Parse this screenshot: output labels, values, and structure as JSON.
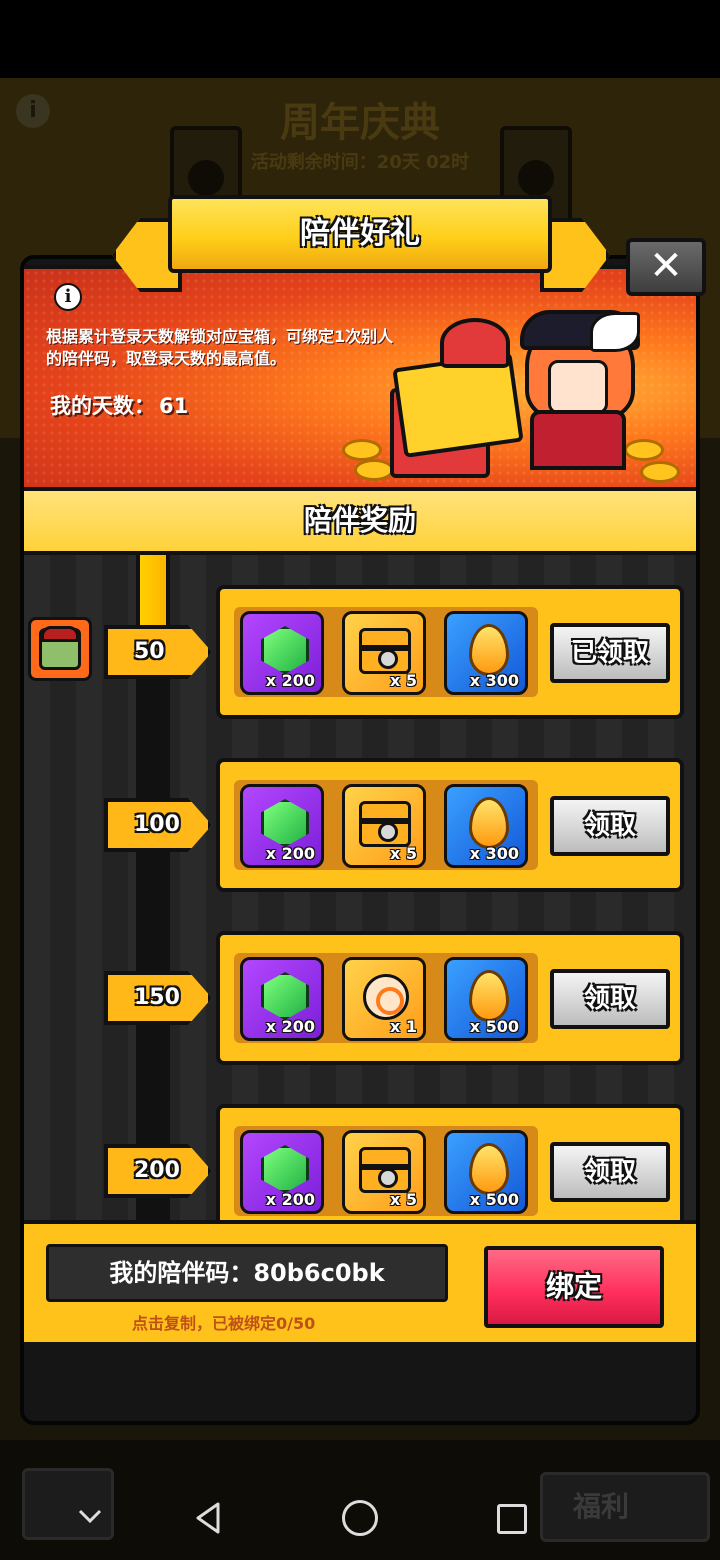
{
  "background": {
    "title": "周年庆典",
    "remaining_time": "活动剩余时间：20天 02时",
    "info_glyph": "i"
  },
  "modal": {
    "title": "陪伴好礼",
    "close_glyph": "✕",
    "info_glyph": "i",
    "description": "根据累计登录天数解锁对应宝箱，可绑定1次别人的陪伴码，取登录天数的最高值。",
    "days_label": "我的天数：",
    "days_value": "61",
    "section_title": "陪伴奖励"
  },
  "tiers": [
    {
      "day": "50",
      "items": [
        {
          "icon": "emerald-gem-icon",
          "qty": "x 200"
        },
        {
          "icon": "treasure-chest-icon",
          "qty": "x 5"
        },
        {
          "icon": "gold-drop-icon",
          "qty": "x 300"
        }
      ],
      "button": "已领取"
    },
    {
      "day": "100",
      "items": [
        {
          "icon": "emerald-gem-icon",
          "qty": "x 200"
        },
        {
          "icon": "treasure-chest-icon",
          "qty": "x 5"
        },
        {
          "icon": "gold-drop-icon",
          "qty": "x 300"
        }
      ],
      "button": "领取"
    },
    {
      "day": "150",
      "items": [
        {
          "icon": "emerald-gem-icon",
          "qty": "x 200"
        },
        {
          "icon": "potion-icon",
          "qty": "x 1"
        },
        {
          "icon": "gold-drop-icon",
          "qty": "x 500"
        }
      ],
      "button": "领取"
    },
    {
      "day": "200",
      "items": [
        {
          "icon": "emerald-gem-icon",
          "qty": "x 200"
        },
        {
          "icon": "treasure-chest-icon",
          "qty": "x 5"
        },
        {
          "icon": "gold-drop-icon",
          "qty": "x 500"
        }
      ],
      "button": "领取"
    }
  ],
  "code_section": {
    "label": "我的陪伴码：80b6c0bk",
    "hint": "点击复制，已被绑定0/50",
    "bind_button": "绑定"
  },
  "game_bottom": {
    "right_tab": "福利"
  },
  "colors": {
    "gold": "#ffc21a",
    "bind_pink": "#ff2d5a",
    "banner_orange": "#e5431a"
  }
}
